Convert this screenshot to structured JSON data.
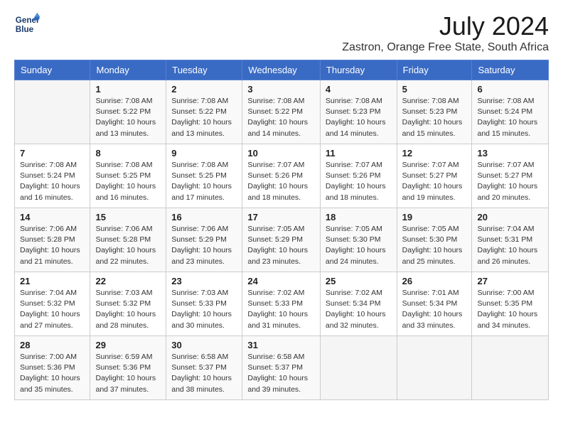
{
  "header": {
    "logo_line1": "General",
    "logo_line2": "Blue",
    "month": "July 2024",
    "location": "Zastron, Orange Free State, South Africa"
  },
  "weekdays": [
    "Sunday",
    "Monday",
    "Tuesday",
    "Wednesday",
    "Thursday",
    "Friday",
    "Saturday"
  ],
  "weeks": [
    [
      {
        "day": "",
        "info": ""
      },
      {
        "day": "1",
        "info": "Sunrise: 7:08 AM\nSunset: 5:22 PM\nDaylight: 10 hours\nand 13 minutes."
      },
      {
        "day": "2",
        "info": "Sunrise: 7:08 AM\nSunset: 5:22 PM\nDaylight: 10 hours\nand 13 minutes."
      },
      {
        "day": "3",
        "info": "Sunrise: 7:08 AM\nSunset: 5:22 PM\nDaylight: 10 hours\nand 14 minutes."
      },
      {
        "day": "4",
        "info": "Sunrise: 7:08 AM\nSunset: 5:23 PM\nDaylight: 10 hours\nand 14 minutes."
      },
      {
        "day": "5",
        "info": "Sunrise: 7:08 AM\nSunset: 5:23 PM\nDaylight: 10 hours\nand 15 minutes."
      },
      {
        "day": "6",
        "info": "Sunrise: 7:08 AM\nSunset: 5:24 PM\nDaylight: 10 hours\nand 15 minutes."
      }
    ],
    [
      {
        "day": "7",
        "info": "Sunrise: 7:08 AM\nSunset: 5:24 PM\nDaylight: 10 hours\nand 16 minutes."
      },
      {
        "day": "8",
        "info": "Sunrise: 7:08 AM\nSunset: 5:25 PM\nDaylight: 10 hours\nand 16 minutes."
      },
      {
        "day": "9",
        "info": "Sunrise: 7:08 AM\nSunset: 5:25 PM\nDaylight: 10 hours\nand 17 minutes."
      },
      {
        "day": "10",
        "info": "Sunrise: 7:07 AM\nSunset: 5:26 PM\nDaylight: 10 hours\nand 18 minutes."
      },
      {
        "day": "11",
        "info": "Sunrise: 7:07 AM\nSunset: 5:26 PM\nDaylight: 10 hours\nand 18 minutes."
      },
      {
        "day": "12",
        "info": "Sunrise: 7:07 AM\nSunset: 5:27 PM\nDaylight: 10 hours\nand 19 minutes."
      },
      {
        "day": "13",
        "info": "Sunrise: 7:07 AM\nSunset: 5:27 PM\nDaylight: 10 hours\nand 20 minutes."
      }
    ],
    [
      {
        "day": "14",
        "info": "Sunrise: 7:06 AM\nSunset: 5:28 PM\nDaylight: 10 hours\nand 21 minutes."
      },
      {
        "day": "15",
        "info": "Sunrise: 7:06 AM\nSunset: 5:28 PM\nDaylight: 10 hours\nand 22 minutes."
      },
      {
        "day": "16",
        "info": "Sunrise: 7:06 AM\nSunset: 5:29 PM\nDaylight: 10 hours\nand 23 minutes."
      },
      {
        "day": "17",
        "info": "Sunrise: 7:05 AM\nSunset: 5:29 PM\nDaylight: 10 hours\nand 23 minutes."
      },
      {
        "day": "18",
        "info": "Sunrise: 7:05 AM\nSunset: 5:30 PM\nDaylight: 10 hours\nand 24 minutes."
      },
      {
        "day": "19",
        "info": "Sunrise: 7:05 AM\nSunset: 5:30 PM\nDaylight: 10 hours\nand 25 minutes."
      },
      {
        "day": "20",
        "info": "Sunrise: 7:04 AM\nSunset: 5:31 PM\nDaylight: 10 hours\nand 26 minutes."
      }
    ],
    [
      {
        "day": "21",
        "info": "Sunrise: 7:04 AM\nSunset: 5:32 PM\nDaylight: 10 hours\nand 27 minutes."
      },
      {
        "day": "22",
        "info": "Sunrise: 7:03 AM\nSunset: 5:32 PM\nDaylight: 10 hours\nand 28 minutes."
      },
      {
        "day": "23",
        "info": "Sunrise: 7:03 AM\nSunset: 5:33 PM\nDaylight: 10 hours\nand 30 minutes."
      },
      {
        "day": "24",
        "info": "Sunrise: 7:02 AM\nSunset: 5:33 PM\nDaylight: 10 hours\nand 31 minutes."
      },
      {
        "day": "25",
        "info": "Sunrise: 7:02 AM\nSunset: 5:34 PM\nDaylight: 10 hours\nand 32 minutes."
      },
      {
        "day": "26",
        "info": "Sunrise: 7:01 AM\nSunset: 5:34 PM\nDaylight: 10 hours\nand 33 minutes."
      },
      {
        "day": "27",
        "info": "Sunrise: 7:00 AM\nSunset: 5:35 PM\nDaylight: 10 hours\nand 34 minutes."
      }
    ],
    [
      {
        "day": "28",
        "info": "Sunrise: 7:00 AM\nSunset: 5:36 PM\nDaylight: 10 hours\nand 35 minutes."
      },
      {
        "day": "29",
        "info": "Sunrise: 6:59 AM\nSunset: 5:36 PM\nDaylight: 10 hours\nand 37 minutes."
      },
      {
        "day": "30",
        "info": "Sunrise: 6:58 AM\nSunset: 5:37 PM\nDaylight: 10 hours\nand 38 minutes."
      },
      {
        "day": "31",
        "info": "Sunrise: 6:58 AM\nSunset: 5:37 PM\nDaylight: 10 hours\nand 39 minutes."
      },
      {
        "day": "",
        "info": ""
      },
      {
        "day": "",
        "info": ""
      },
      {
        "day": "",
        "info": ""
      }
    ]
  ]
}
